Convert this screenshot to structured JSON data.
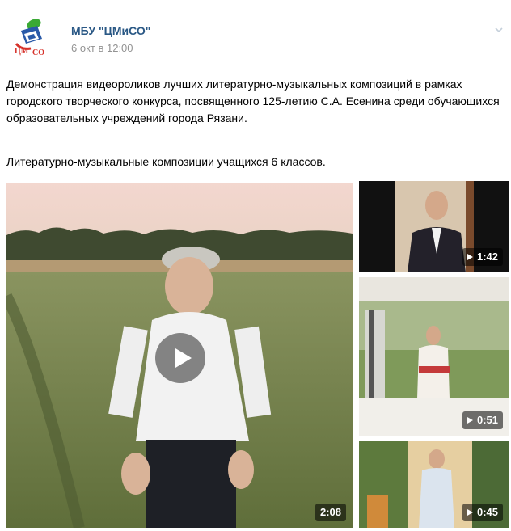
{
  "post": {
    "author": "МБУ \"ЦМиСО\"",
    "time": "6 окт в 12:00",
    "text1": "Демонстрация видеороликов лучших литературно-музыкальных композиций в рамках городского творческого конкурса, посвященного 125-летию С.А. Есенина среди обучающихся образовательных учреждений города Рязани.",
    "text2": "Литературно-музыкальные композиции учащихся 6 классов."
  },
  "videos": [
    {
      "duration": "2:08"
    },
    {
      "duration": "1:42"
    },
    {
      "duration": "0:51"
    },
    {
      "duration": "0:45"
    }
  ],
  "colors": {
    "author": "#2a5885",
    "time": "#939393",
    "logo_green": "#3aa935",
    "logo_blue": "#2a5aa8",
    "logo_red": "#d6322b"
  }
}
